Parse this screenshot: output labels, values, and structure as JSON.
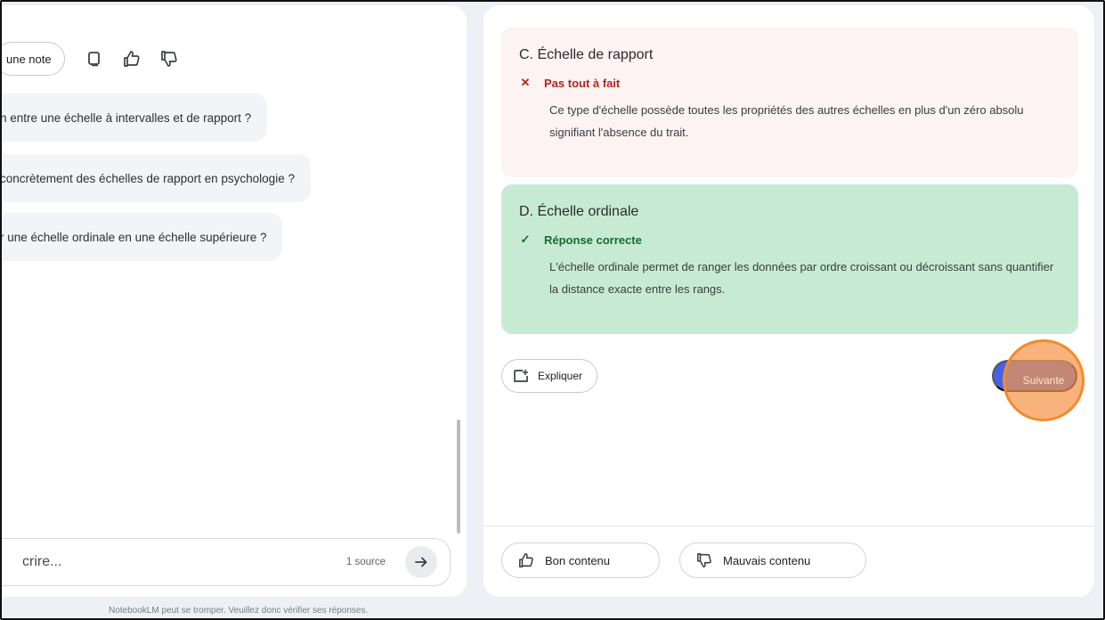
{
  "chat": {
    "note_button": "une note",
    "actions": [
      "copy-icon",
      "thumbs-up-icon",
      "thumbs-down-icon"
    ],
    "suggestions": [
      "n entre une échelle à intervalles et de rapport ?",
      "concrètement des échelles de rapport en psychologie ?",
      "r une échelle ordinale en une échelle supérieure ?"
    ],
    "input_placeholder": "crire...",
    "source_count": "1 source",
    "footer": "NotebookLM peut se tromper. Veuillez donc vérifier ses réponses."
  },
  "quiz": {
    "option_c": {
      "title": "C.  Échelle de rapport",
      "verdict": "Pas tout à fait",
      "explanation": "Ce type d'échelle possède toutes les propriétés des autres échelles en plus d'un zéro absolu signifiant l'absence du trait."
    },
    "option_d": {
      "title": "D.  Échelle ordinale",
      "verdict": "Réponse correcte",
      "explanation": "L'échelle ordinale permet de ranger les données par ordre croissant ou décroissant sans quantifier la distance exacte entre les rangs."
    },
    "explain_button": "Expliquer",
    "next_button": "Suivante",
    "feedback_good": "Bon contenu",
    "feedback_bad": "Mauvais contenu"
  },
  "colors": {
    "incorrect_bg": "#fcf3f2",
    "incorrect_text": "#b3261e",
    "correct_bg": "#c7ebd2",
    "correct_text": "#146c2e",
    "primary": "#4661e8",
    "highlight": "#f28a2e"
  }
}
